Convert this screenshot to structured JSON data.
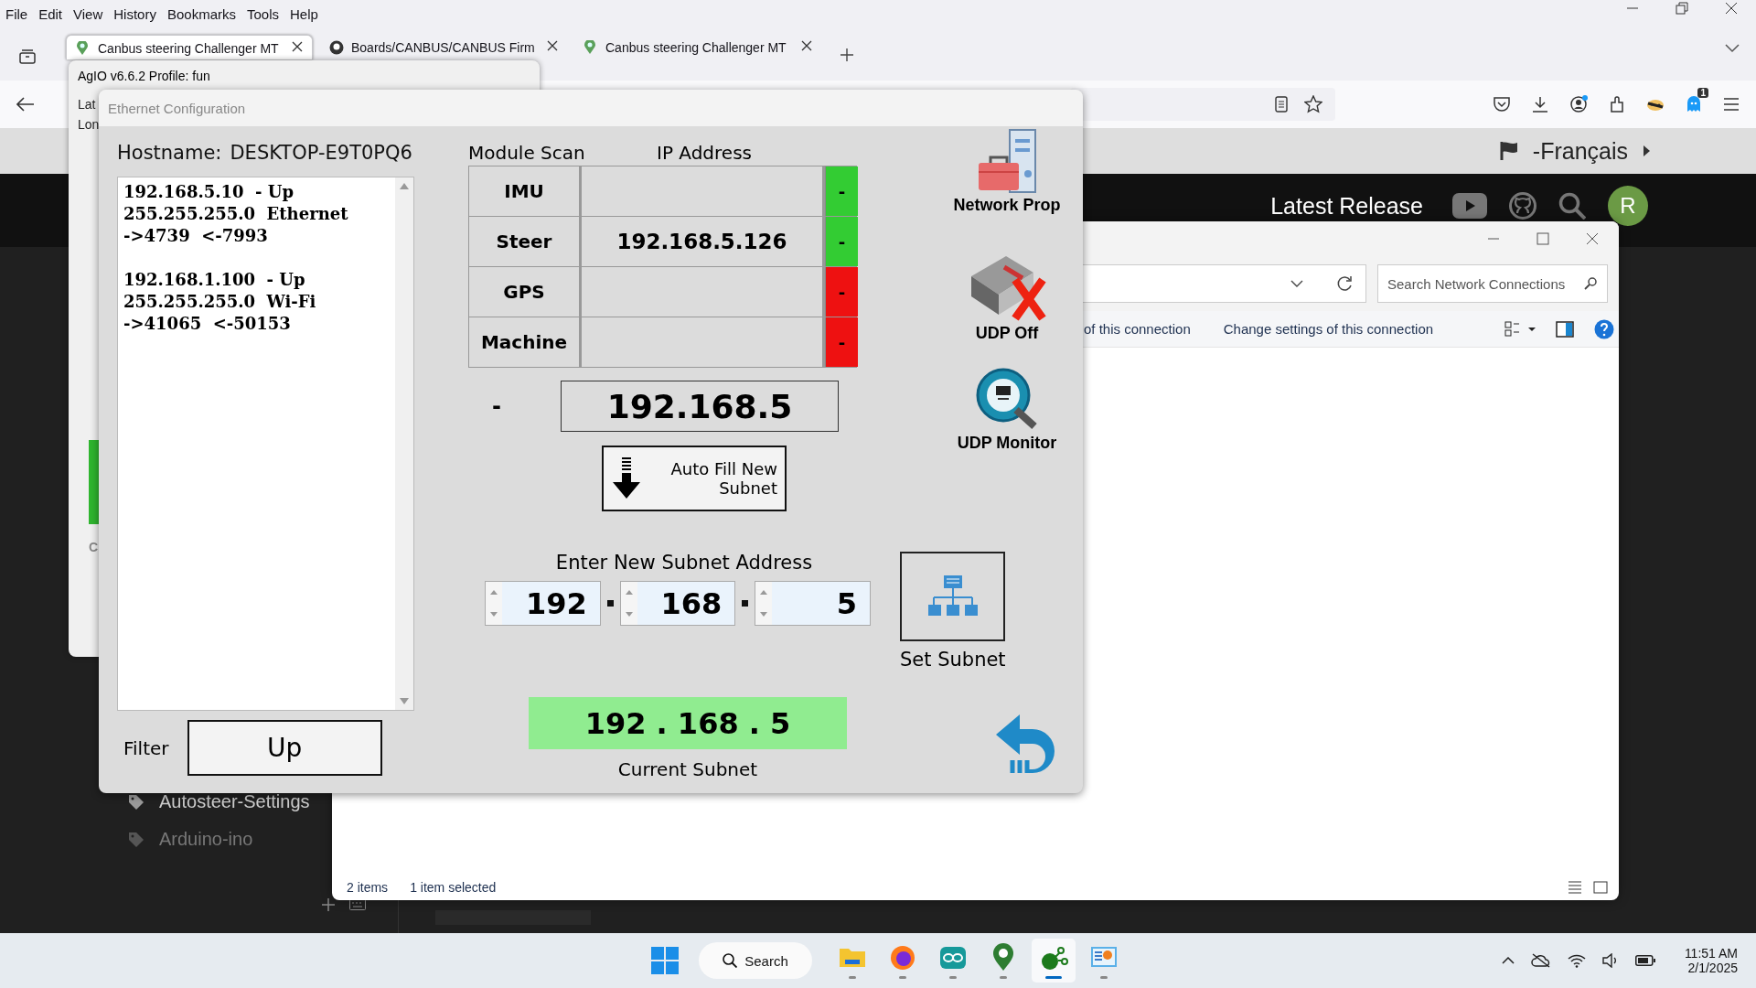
{
  "browser": {
    "menu": [
      "File",
      "Edit",
      "View",
      "History",
      "Bookmarks",
      "Tools",
      "Help"
    ],
    "tabs": [
      {
        "title": "Canbus steering Challenger MT",
        "selected": true,
        "kind": "pin"
      },
      {
        "title": "Boards/CANBUS/CANBUS Firm",
        "selected": false,
        "kind": "github"
      },
      {
        "title": "Canbus steering Challenger MT",
        "selected": false,
        "kind": "pin"
      }
    ],
    "notification_badge": "1"
  },
  "page": {
    "language": "-Français",
    "header_link": "Latest Release",
    "avatar": "R",
    "sidebar_tags": [
      {
        "label": "Autosteer-Settings",
        "dim": false
      },
      {
        "label": "Arduino-ino",
        "dim": true
      }
    ]
  },
  "explorer": {
    "search": {
      "placeholder": "Search Network Connections"
    },
    "commands": [
      "of this connection",
      "Change settings of this connection"
    ],
    "status_bar": [
      "2 items",
      "1 item selected"
    ]
  },
  "agio": {
    "title": "AgIO  v6.6.2 Profile: fun",
    "labels": [
      "Lat",
      "Lon",
      "C"
    ]
  },
  "dialog": {
    "title": "Ethernet Configuration",
    "hostname_label": "Hostname:",
    "hostname": "DESKTOP-E9T0PQ6",
    "interfaces": [
      {
        "lines": [
          "192.168.5.10  - Up",
          "255.255.255.0  Ethernet",
          "->4739  <-7993"
        ]
      },
      {
        "lines": [
          "192.168.1.100  - Up",
          "255.255.255.0  Wi-Fi",
          "->41065  <-50153"
        ]
      }
    ],
    "filter_label": "Filter",
    "filter_value": "Up",
    "columns": [
      "Module Scan",
      "IP Address"
    ],
    "modules": [
      {
        "name": "IMU",
        "found": true,
        "status": "-"
      },
      {
        "name": "Steer",
        "ip": "192.168.5.126",
        "found": true,
        "status": "-"
      },
      {
        "name": "GPS",
        "found": false,
        "status": "-"
      },
      {
        "name": "Machine",
        "found": false,
        "status": "-"
      }
    ],
    "scan_dash": "-",
    "scanned_subnet": "192.168.5",
    "auto_fill_button": [
      "Auto Fill New",
      "Subnet"
    ],
    "new_subnet_label": "Enter New Subnet Address",
    "octets": [
      "192",
      "168",
      "5"
    ],
    "set_subnet_label": "Set Subnet",
    "current_subnet": "192 . 168 . 5",
    "current_subnet_label": "Current Subnet",
    "tools": [
      {
        "label": "Network Prop",
        "kind": "netprop"
      },
      {
        "label": "UDP Off",
        "kind": "udpoff"
      },
      {
        "label": "UDP Monitor",
        "kind": "monitor"
      }
    ]
  },
  "taskbar": {
    "search": "Search",
    "apps": [
      {
        "selected": false
      },
      {
        "selected": false
      },
      {
        "selected": false
      },
      {
        "selected": false
      },
      {
        "selected": true
      },
      {
        "selected": false
      }
    ],
    "time": "11:51 AM",
    "date": "2/1/2025"
  }
}
